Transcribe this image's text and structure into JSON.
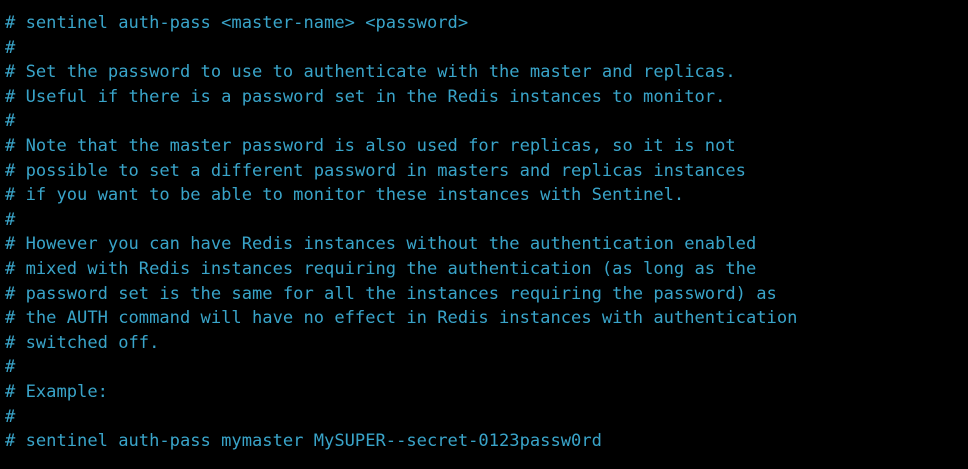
{
  "terminal": {
    "text_color": "#39a4c9",
    "background_color": "#000000",
    "lines": [
      "# sentinel auth-pass <master-name> <password>",
      "#",
      "# Set the password to use to authenticate with the master and replicas.",
      "# Useful if there is a password set in the Redis instances to monitor.",
      "#",
      "# Note that the master password is also used for replicas, so it is not",
      "# possible to set a different password in masters and replicas instances",
      "# if you want to be able to monitor these instances with Sentinel.",
      "#",
      "# However you can have Redis instances without the authentication enabled",
      "# mixed with Redis instances requiring the authentication (as long as the",
      "# password set is the same for all the instances requiring the password) as",
      "# the AUTH command will have no effect in Redis instances with authentication",
      "# switched off.",
      "#",
      "# Example:",
      "#",
      "# sentinel auth-pass mymaster MySUPER--secret-0123passw0rd"
    ]
  }
}
